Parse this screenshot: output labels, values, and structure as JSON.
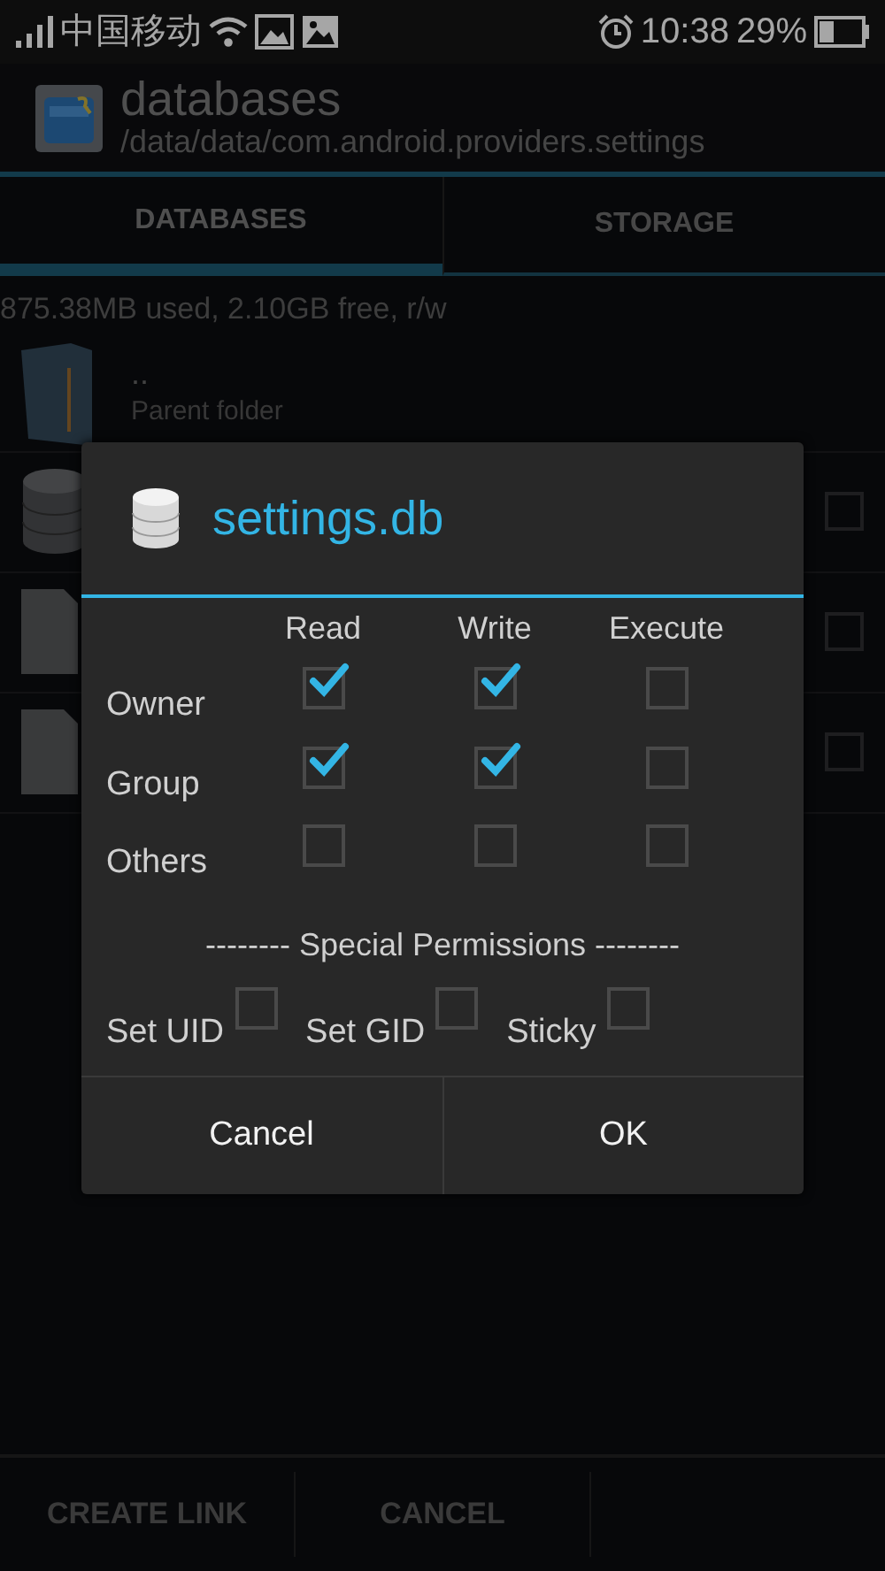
{
  "status_bar": {
    "carrier": "中国移动",
    "time": "10:38",
    "battery": "29%"
  },
  "header": {
    "title": "databases",
    "path": "/data/data/com.android.providers.settings"
  },
  "tabs": [
    {
      "label": "DATABASES",
      "selected": true
    },
    {
      "label": "STORAGE",
      "selected": false
    }
  ],
  "storage_info": "875.38MB used, 2.10GB free, r/w",
  "files": [
    {
      "kind": "parent",
      "name": "..",
      "subtitle": "Parent folder"
    },
    {
      "kind": "database",
      "checked": false
    },
    {
      "kind": "file",
      "checked": false
    },
    {
      "kind": "file",
      "checked": false
    }
  ],
  "dialog": {
    "title": "settings.db",
    "columns": [
      "Read",
      "Write",
      "Execute"
    ],
    "rows": [
      {
        "label": "Owner",
        "permissions": [
          {
            "checked": true
          },
          {
            "checked": true
          },
          {
            "checked": false
          }
        ]
      },
      {
        "label": "Group",
        "permissions": [
          {
            "checked": true
          },
          {
            "checked": true
          },
          {
            "checked": false
          }
        ]
      },
      {
        "label": "Others",
        "permissions": [
          {
            "checked": false
          },
          {
            "checked": false
          },
          {
            "checked": false
          }
        ]
      }
    ],
    "special_heading": "-------- Special Permissions --------",
    "special": [
      {
        "label": "Set UID",
        "checked": false
      },
      {
        "label": "Set GID",
        "checked": false
      },
      {
        "label": "Sticky",
        "checked": false
      }
    ],
    "buttons": [
      "Cancel",
      "OK"
    ]
  },
  "bottom_bar": [
    "CREATE LINK",
    "CANCEL"
  ]
}
